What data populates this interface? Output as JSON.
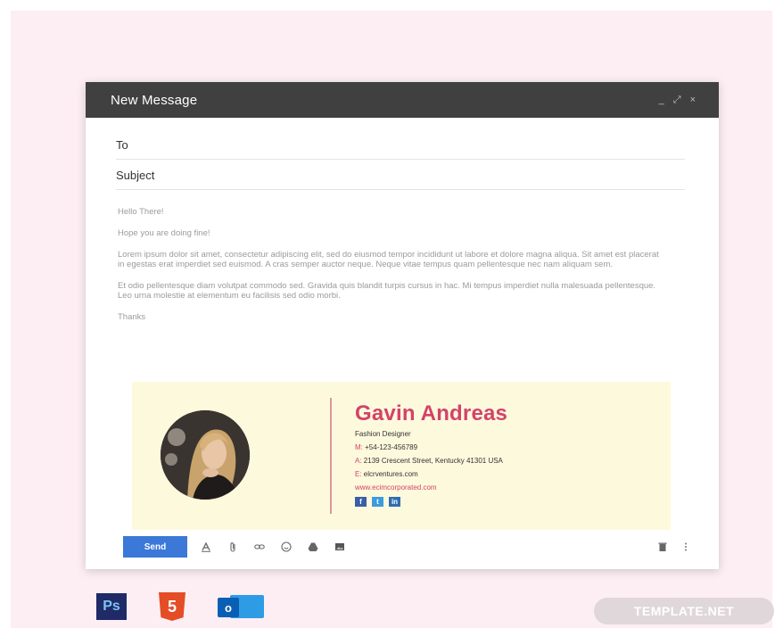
{
  "window": {
    "title": "New Message",
    "controls": [
      "_",
      "⤢",
      "×"
    ]
  },
  "compose": {
    "to_label": "To",
    "subject_label": "Subject",
    "body": {
      "greeting": "Hello There!",
      "line2": "Hope you are doing fine!",
      "para1": "Lorem ipsum dolor sit amet, consectetur adipiscing elit, sed do eiusmod tempor incididunt ut labore et dolore magna aliqua. Sit amet est placerat in egestas erat imperdiet sed euismod. A cras semper auctor neque. Neque vitae tempus quam pellentesque nec nam aliquam sem.",
      "para2": "Et odio pellentesque diam volutpat commodo sed. Gravida quis blandit turpis cursus in hac. Mi tempus imperdiet nulla malesuada pellentesque. Leo urna molestie at elementum eu facilisis sed odio morbi.",
      "closing": "Thanks"
    }
  },
  "signature": {
    "name": "Gavin Andreas",
    "role": "Fashion Designer",
    "mobile_key": "M:",
    "mobile": "+54-123-456789",
    "address_key": "A:",
    "address": "2139  Crescent Street, Kentucky 41301 USA",
    "email_key": "E:",
    "email": "elcrventures.com",
    "website": "www.ecimcorporated.com",
    "social": {
      "facebook": "f",
      "twitter": "t",
      "linkedin": "in"
    }
  },
  "toolbar": {
    "send_label": "Send"
  },
  "apps": {
    "ps": "Ps",
    "html5": "5",
    "outlook": "o"
  },
  "watermark": "TEMPLATE.NET"
}
